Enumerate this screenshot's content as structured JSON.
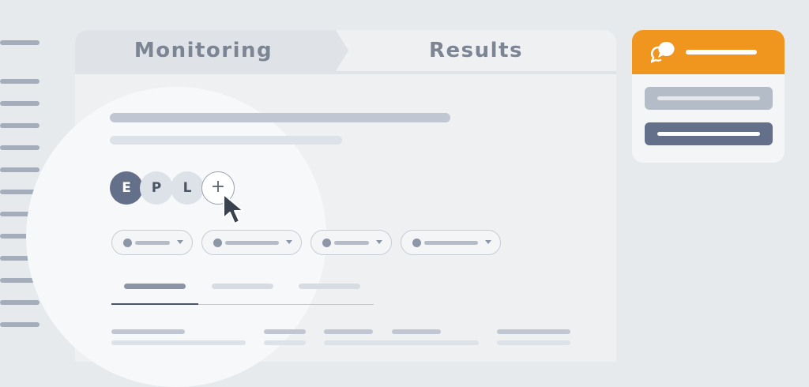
{
  "tabs": {
    "monitoring_label": "Monitoring",
    "results_label": "Results",
    "active": "monitoring"
  },
  "avatars": [
    {
      "initial": "E"
    },
    {
      "initial": "P"
    },
    {
      "initial": "L"
    }
  ],
  "add_avatar_symbol": "+",
  "icons": {
    "chat": "chat-bubble-icon",
    "cursor": "mouse-pointer-icon",
    "add": "plus-icon",
    "dropdown": "caret-down-icon"
  },
  "colors": {
    "accent_orange": "#f0961f",
    "avatar_active": "#64708a",
    "primary_button": "#64708a",
    "secondary_button": "#b4bcc8"
  },
  "selected_subtab_index": 0
}
